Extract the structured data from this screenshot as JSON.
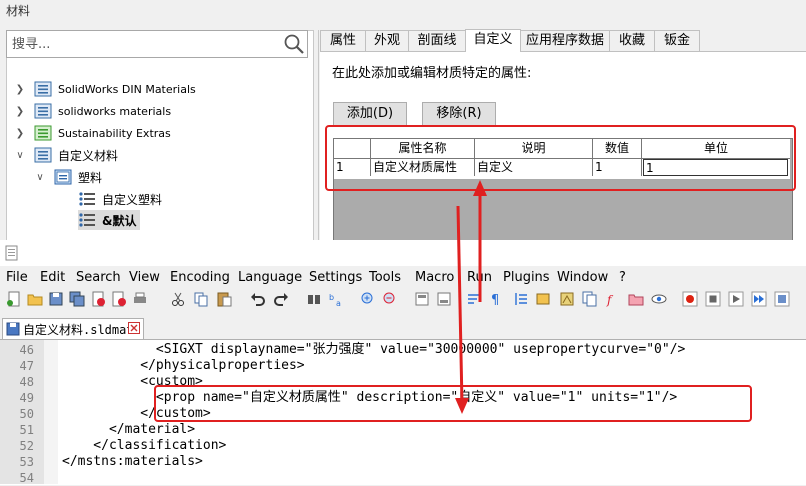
{
  "dialog": {
    "title": "材料",
    "search_placeholder": "搜寻...",
    "tree": [
      {
        "label": "SolidWorks DIN Materials",
        "icon": "material-library-icon",
        "expanded": false
      },
      {
        "label": "solidworks materials",
        "icon": "material-library-icon",
        "expanded": false
      },
      {
        "label": "Sustainability Extras",
        "icon": "green-library-icon",
        "expanded": false
      },
      {
        "label": "自定义材料",
        "icon": "material-library-icon",
        "expanded": true
      },
      {
        "label": "塑料",
        "icon": "category-folder-icon",
        "expanded": true
      },
      {
        "label": "自定义塑料",
        "icon": "material-item-icon"
      },
      {
        "label": "&默认",
        "icon": "material-item-icon",
        "selected": true
      }
    ],
    "tabs": [
      "属性",
      "外观",
      "剖面线",
      "自定义",
      "应用程序数据",
      "收藏",
      "钣金"
    ],
    "active_tab": "自定义",
    "panel_hint": "在此处添加或编辑材质特定的属性:",
    "add_button": "添加(D)",
    "remove_button": "移除(R)",
    "grid": {
      "columns": [
        "",
        "属性名称",
        "说明",
        "数值",
        "单位"
      ],
      "rows": [
        [
          "1",
          "自定义材质属性",
          "自定义",
          "1",
          "1"
        ]
      ]
    },
    "highlight_color": "#e02020"
  },
  "editor": {
    "menu": [
      "File",
      "Edit",
      "Search",
      "View",
      "Encoding",
      "Language",
      "Settings",
      "Tools",
      "Macro",
      "Run",
      "Plugins",
      "Window",
      "?"
    ],
    "doc_tab": "自定义材料.sldmat",
    "lines": [
      {
        "n": "46",
        "text": "            <SIGXT displayname=\"张力强度\" value=\"30000000\" usepropertycurve=\"0\"/>"
      },
      {
        "n": "47",
        "text": "          </physicalproperties>"
      },
      {
        "n": "48",
        "text": "          <custom>"
      },
      {
        "n": "49",
        "text": "            <prop name=\"自定义材质属性\" description=\"自定义\" value=\"1\" units=\"1\"/>"
      },
      {
        "n": "50",
        "text": "          </custom>"
      },
      {
        "n": "51",
        "text": "      </material>"
      },
      {
        "n": "52",
        "text": "    </classification>"
      },
      {
        "n": "53",
        "text": "</mstns:materials>"
      },
      {
        "n": "54",
        "text": ""
      }
    ]
  }
}
